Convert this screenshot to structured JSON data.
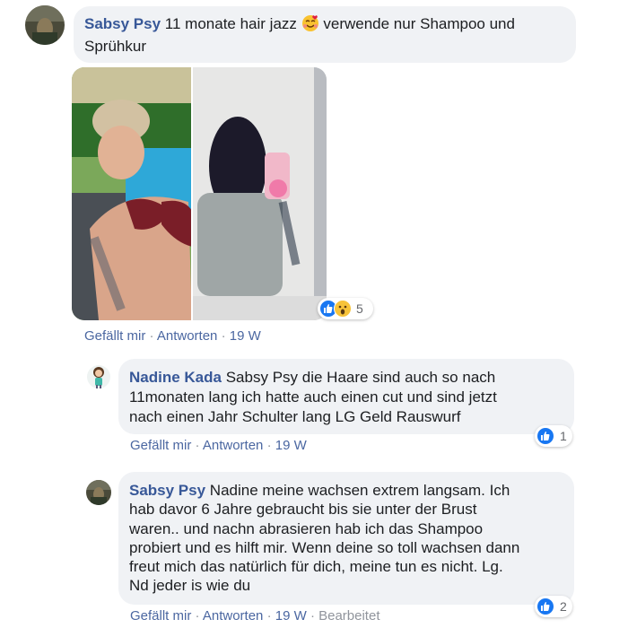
{
  "comments": [
    {
      "author": "Sabsy Psy",
      "text_before_emoji": "11 monate hair jazz",
      "emoji": "smiling-face-with-hearts",
      "text_after_emoji": "verwende nur Shampoo und",
      "text_line2": "Sprühkur",
      "reactions": {
        "icons": [
          "like",
          "wow"
        ],
        "count": "5"
      },
      "actions": {
        "like": "Gefällt mir",
        "reply": "Antworten",
        "time": "19 W"
      }
    },
    {
      "author": "Nadine Kada",
      "lines": [
        "Sabsy Psy die Haare sind auch so nach",
        "11monaten lang ich hatte auch einen cut und sind jetzt",
        "nach einen Jahr Schulter lang LG Geld Rauswurf"
      ],
      "reactions": {
        "icons": [
          "like"
        ],
        "count": "1"
      },
      "actions": {
        "like": "Gefällt mir",
        "reply": "Antworten",
        "time": "19 W"
      }
    },
    {
      "author": "Sabsy Psy",
      "lines": [
        "Nadine meine wachsen extrem langsam. Ich",
        "hab davor 6 Jahre gebraucht bis sie unter der Brust",
        "waren.. und nachn abrasieren hab ich das Shampoo",
        "probiert und es hilft mir. Wenn deine so toll wachsen dann",
        "freut mich das natürlich für dich, meine tun es nicht. Lg.",
        "Nd jeder is wie du"
      ],
      "reactions": {
        "icons": [
          "like"
        ],
        "count": "2"
      },
      "actions": {
        "like": "Gefällt mir",
        "reply": "Antworten",
        "time": "19 W",
        "edited": "Bearbeitet"
      }
    }
  ],
  "colors": {
    "author": "#385898",
    "link": "#4b67a1",
    "meta": "#90949c",
    "bubble": "#f0f2f5",
    "like": "#1877f2"
  }
}
